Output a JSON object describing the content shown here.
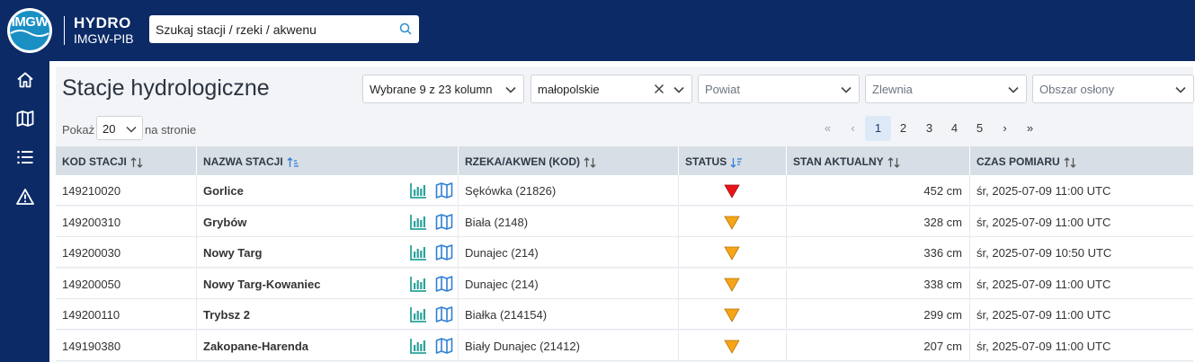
{
  "header": {
    "logo_text": "IMGW",
    "brand_title": "HYDRO",
    "brand_subtitle": "IMGW-PIB",
    "search_placeholder": "Szukaj stacji / rzeki / akwenu"
  },
  "sidebar": {
    "items": [
      {
        "icon": "home-icon"
      },
      {
        "icon": "map-icon"
      },
      {
        "icon": "list-icon"
      },
      {
        "icon": "warning-icon"
      }
    ]
  },
  "page": {
    "title": "Stacje hydrologiczne"
  },
  "filters": {
    "columns": "Wybrane 9 z 23 kolumn",
    "voivodeship": "małopolskie",
    "county_placeholder": "Powiat",
    "catchment_placeholder": "Zlewnia",
    "protected_area_placeholder": "Obszar osłony"
  },
  "pagination": {
    "show_label": "Pokaż",
    "page_size": "20",
    "per_page_label": "na stronie",
    "first": "«",
    "prev": "‹",
    "pages": [
      "1",
      "2",
      "3",
      "4",
      "5"
    ],
    "current_page": "1",
    "next": "›",
    "last": "»"
  },
  "table": {
    "columns": {
      "code": "KOD STACJI",
      "name": "NAZWA STACJI",
      "river": "RZEKA/AKWEN (KOD)",
      "status": "STATUS",
      "level": "STAN AKTUALNY",
      "time": "CZAS POMIARU"
    },
    "rows": [
      {
        "code": "149210020",
        "name": "Gorlice",
        "river": "Sękówka (21826)",
        "status": "alarm",
        "level": "452 cm",
        "time": "śr, 2025-07-09 11:00 UTC"
      },
      {
        "code": "149200310",
        "name": "Grybów",
        "river": "Biała (2148)",
        "status": "warning",
        "level": "328 cm",
        "time": "śr, 2025-07-09 11:00 UTC"
      },
      {
        "code": "149200030",
        "name": "Nowy Targ",
        "river": "Dunajec (214)",
        "status": "warning",
        "level": "336 cm",
        "time": "śr, 2025-07-09 10:50 UTC"
      },
      {
        "code": "149200050",
        "name": "Nowy Targ-Kowaniec",
        "river": "Dunajec (214)",
        "status": "warning",
        "level": "338 cm",
        "time": "śr, 2025-07-09 11:00 UTC"
      },
      {
        "code": "149200110",
        "name": "Trybsz 2",
        "river": "Białka (214154)",
        "status": "warning",
        "level": "299 cm",
        "time": "śr, 2025-07-09 11:00 UTC"
      },
      {
        "code": "149190380",
        "name": "Zakopane-Harenda",
        "river": "Biały Dunajec (21412)",
        "status": "warning",
        "level": "207 cm",
        "time": "śr, 2025-07-09 11:00 UTC"
      }
    ]
  },
  "colors": {
    "navy": "#0b2a66",
    "alarm": "#e8141c",
    "warning": "#f5a516",
    "teal": "#2aa39a",
    "sort_blue": "#2f7fd6"
  }
}
